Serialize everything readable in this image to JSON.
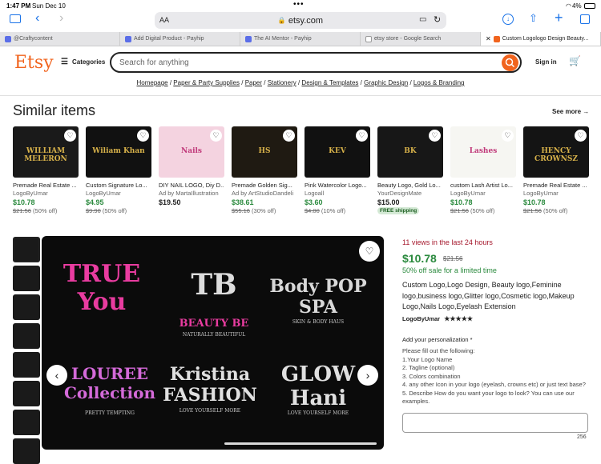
{
  "status": {
    "time": "1:47 PM",
    "date": "Sun Dec 10",
    "battery": "4%"
  },
  "browser": {
    "text_size": "AA",
    "url": "etsy.com",
    "tabs": [
      {
        "label": "@Craftycontent",
        "active": false
      },
      {
        "label": "Add Digital Product - Payhip",
        "active": false
      },
      {
        "label": "The AI Mentor - Payhip",
        "active": false
      },
      {
        "label": "etsy store - Google Search",
        "active": false
      },
      {
        "label": "Custom Logologo Design Beauty...",
        "active": true
      }
    ]
  },
  "header": {
    "logo": "Etsy",
    "categories": "Categories",
    "search_placeholder": "Search for anything",
    "sign_in": "Sign in"
  },
  "breadcrumb": [
    "Homepage",
    "Paper & Party Supplies",
    "Paper",
    "Stationery",
    "Design & Templates",
    "Graphic Design",
    "Logos & Branding"
  ],
  "similar": {
    "title": "Similar items",
    "see_more": "See more",
    "items": [
      {
        "title": "Premade Real Estate ...",
        "seller": "LogoByUmar",
        "price": "$10.78",
        "orig": "$21.56",
        "off": "(50% off)",
        "sale": true,
        "color": "#1a1a1a",
        "img_text": "WILLIAM MELERON"
      },
      {
        "title": "Custom Signature Lo...",
        "seller": "LogoByUmar",
        "price": "$4.95",
        "orig": "$9.90",
        "off": "(50% off)",
        "sale": true,
        "color": "#111111",
        "img_text": "Wiliam Khan"
      },
      {
        "title": "DIY NAIL LOGO, Diy D...",
        "seller": "Ad by MartaIllustration",
        "price": "$19.50",
        "orig": "",
        "off": "",
        "sale": false,
        "color": "#f4d3e0",
        "img_text": "Nails"
      },
      {
        "title": "Premade Golden Sig...",
        "seller": "Ad by ArtStudioDandeli",
        "price": "$38.61",
        "orig": "$55.16",
        "off": "(30% off)",
        "sale": true,
        "color": "#1f1a12",
        "img_text": "HS"
      },
      {
        "title": "Pink Watercolor Logo...",
        "seller": "Logoall",
        "price": "$3.60",
        "orig": "$4.00",
        "off": "(10% off)",
        "sale": true,
        "color": "#111111",
        "img_text": "KEV"
      },
      {
        "title": "Beauty Logo, Gold Lo...",
        "seller": "YourDesignMate",
        "price": "$15.00",
        "orig": "",
        "off": "",
        "sale": false,
        "free": "FREE shipping",
        "color": "#171717",
        "img_text": "BK"
      },
      {
        "title": "custom Lash Artist Lo...",
        "seller": "LogoByUmar",
        "price": "$10.78",
        "orig": "$21.56",
        "off": "(50% off)",
        "sale": true,
        "color": "#f6f6f2",
        "img_text": "Lashes"
      },
      {
        "title": "Premade Real Estate ...",
        "seller": "LogoByUmar",
        "price": "$10.78",
        "orig": "$21.56",
        "off": "(50% off)",
        "sale": true,
        "color": "#141414",
        "img_text": "HENCY CROWNSZ"
      }
    ]
  },
  "listing": {
    "views": "11 views in the last 24 hours",
    "price": "$10.78",
    "orig": "$21.56",
    "sale_note": "50% off sale for a limited time",
    "description": "Custom Logo,Logo Design, Beauty logo,Feminine logo,business logo,Glitter logo,Cosmetic logo,Makeup Logo,Nails Logo,Eyelash Extension",
    "seller": "LogoByUmar",
    "stars": "★★★★★",
    "personalization_label": "Add your personalization *",
    "instructions": "Please fill out the following:\n1.Your Logo Name\n2. Tagline (optional)\n3. Colors combination\n4. any other Icon in your logo (eyelash, crowns etc) or just text base?\n5. Describe How do you want your logo to look? You can use our examples.",
    "char_count": "256",
    "hero_texts": [
      "TRUE You",
      "BEAUTY BE",
      "Body POP SPA",
      "LOUREE Collection",
      "Kristina FASHION",
      "GLOW Hani",
      "TB",
      "NATURALLY BEAUTIFUL",
      "SKIN & BODY HAUS",
      "PRETTY TEMPTING",
      "LOVE YOURSELF MORE",
      "LOVE YOURSELF MORE"
    ]
  }
}
